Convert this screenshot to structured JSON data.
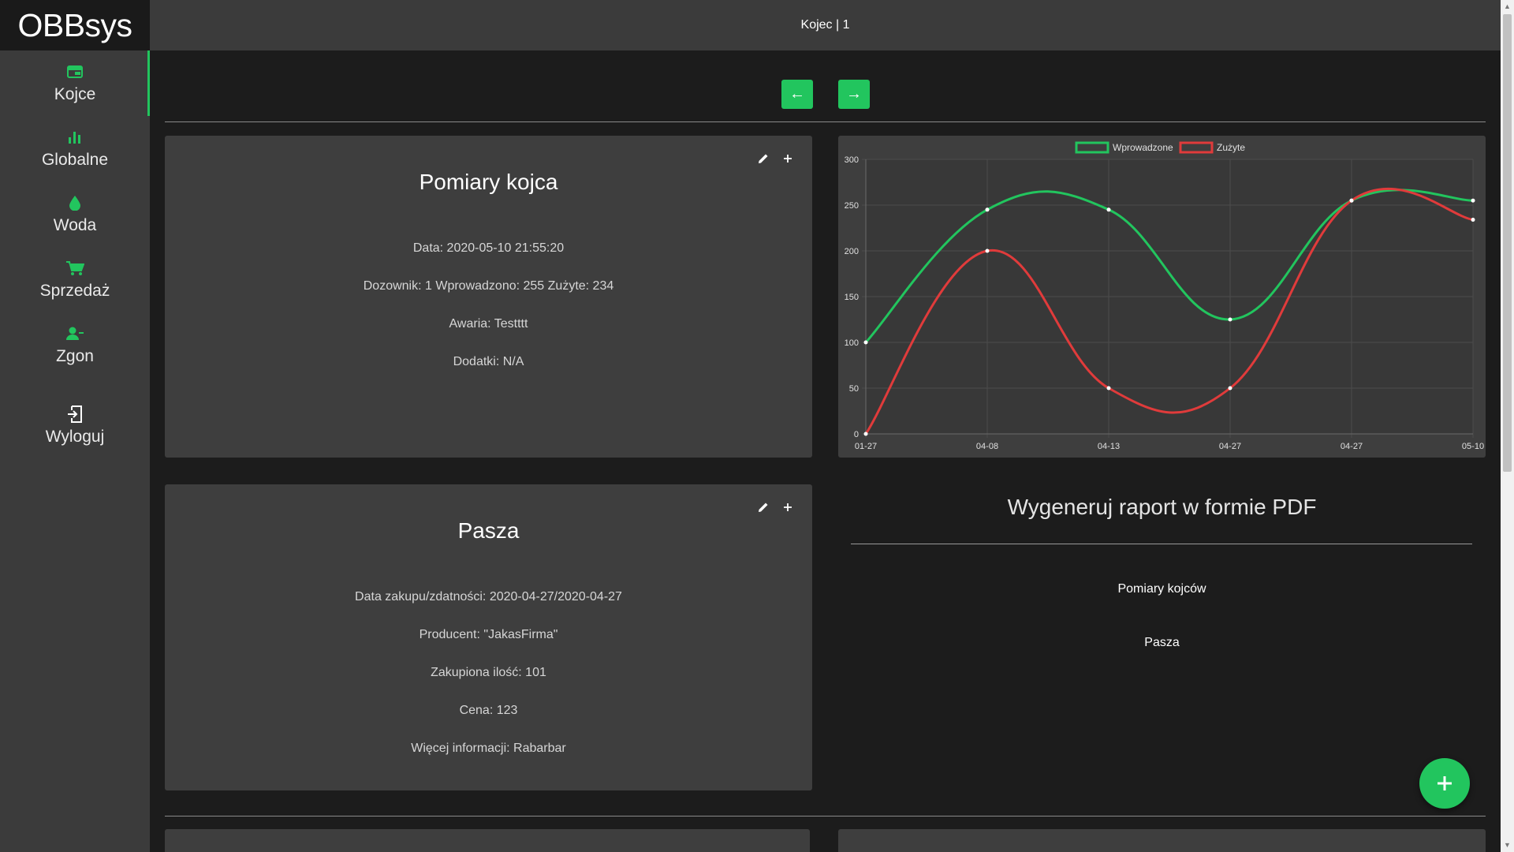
{
  "app": {
    "brand": "OBBsys",
    "page_title": "Kojec | 1"
  },
  "colors": {
    "accent": "#22c55e",
    "series_in": "#22c55e",
    "series_used": "#e03b3b"
  },
  "sidebar": {
    "items": [
      {
        "label": "Kojce",
        "icon": "pen-icon"
      },
      {
        "label": "Globalne",
        "icon": "bar-chart-icon"
      },
      {
        "label": "Woda",
        "icon": "water-drop-icon"
      },
      {
        "label": "Sprzedaż",
        "icon": "cart-icon"
      },
      {
        "label": "Zgon",
        "icon": "user-minus-icon"
      },
      {
        "label": "Wyloguj",
        "icon": "logout-icon"
      }
    ]
  },
  "pager": {
    "prev": "←",
    "next": "→"
  },
  "measurements": {
    "title": "Pomiary kojca",
    "lines": [
      "Data: 2020-05-10 21:55:20",
      "Dozownik: 1 Wprowadzono: 255 Zużyte: 234",
      "Awaria: Testttt",
      "Dodatki: N/A"
    ]
  },
  "feed": {
    "title": "Pasza",
    "lines": [
      "Data zakupu/zdatności: 2020-04-27/2020-04-27",
      "Producent: \"JakasFirma\"",
      "Zakupiona ilość: 101",
      "Cena: 123",
      "Więcej informacji: Rabarbar"
    ]
  },
  "chart_data": {
    "type": "line",
    "categories": [
      "01-27",
      "04-08",
      "04-13",
      "04-27",
      "04-27",
      "05-10"
    ],
    "series": [
      {
        "name": "Wprowadzone",
        "values": [
          100,
          245,
          245,
          125,
          255,
          255
        ]
      },
      {
        "name": "Zużyte",
        "values": [
          0,
          200,
          50,
          50,
          255,
          234
        ]
      }
    ],
    "ylim": [
      0,
      300
    ],
    "yticks": [
      0,
      50,
      100,
      150,
      200,
      250,
      300
    ],
    "grid": true,
    "legend": "top-center",
    "title": "",
    "xlabel": "",
    "ylabel": ""
  },
  "pdf": {
    "title": "Wygeneruj raport w formie PDF",
    "links": [
      "Pomiary kojców",
      "Pasza"
    ]
  },
  "fab": {
    "icon": "plus-icon"
  }
}
